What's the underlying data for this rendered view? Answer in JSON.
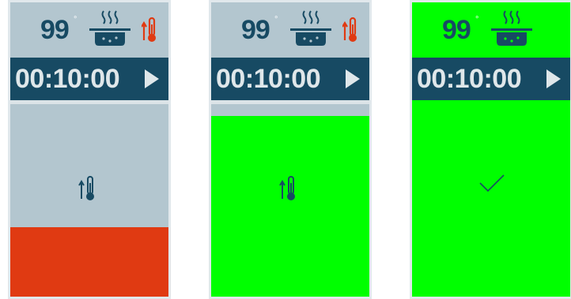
{
  "panels": [
    {
      "temperature": "99",
      "degree_symbol": "°",
      "timer": "00:10:00",
      "header_state": "heating",
      "body_icon": "thermometer-up-icon",
      "fill_color": "#e03a12",
      "fill_fraction": 0.36,
      "show_heat_indicator": true
    },
    {
      "temperature": "99",
      "degree_symbol": "°",
      "timer": "00:10:00",
      "header_state": "heating",
      "body_icon": "thermometer-up-icon",
      "fill_color": "#00ff00",
      "fill_fraction": 0.94,
      "show_heat_indicator": true
    },
    {
      "temperature": "99",
      "degree_symbol": "°",
      "timer": "00:10:00",
      "header_state": "ready",
      "body_icon": "checkmark-icon",
      "fill_color": "#00ff00",
      "fill_fraction": 1.0,
      "show_heat_indicator": false
    }
  ],
  "colors": {
    "panel_bg": "#b3c6cf",
    "timer_bg": "#174a63",
    "text_dark": "#174a63",
    "heat_red": "#e03a12",
    "ready_green": "#00ff00"
  }
}
